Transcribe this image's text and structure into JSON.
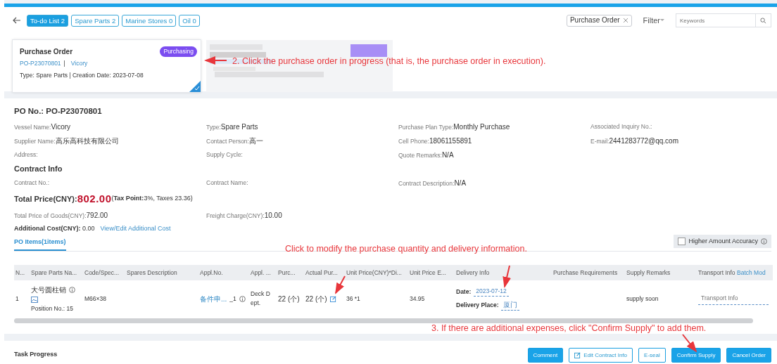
{
  "tabs": [
    {
      "label": "To-do List 2",
      "selected": true
    },
    {
      "label": "Spare Parts 2",
      "selected": false
    },
    {
      "label": "Marine Stores 0",
      "selected": false
    },
    {
      "label": "Oil 0",
      "selected": false
    }
  ],
  "filter_chip": {
    "label": "Purchase Order"
  },
  "filter": {
    "label": "Filter"
  },
  "search": {
    "placeholder": "Keywords"
  },
  "order_card": {
    "title": "Purchase Order",
    "status": "Purchasing",
    "po_no": "PO-P23070801",
    "separator": "|",
    "vessel": "Vicory",
    "meta": "Type:  Spare Parts | Creation Date:  2023-07-08",
    "selected": true
  },
  "details": {
    "po_title": "PO No.:  PO-P23070801",
    "rows": [
      [
        {
          "label": "Vessel Name:",
          "value": "Vicory"
        },
        {
          "label": "Type:",
          "value": "Spare Parts"
        },
        {
          "label": "Purchase Plan Type:",
          "value": "Monthly Purchase"
        },
        {
          "label": "Associated Inquiry No.:"
        }
      ],
      [
        {
          "label": "Supplier Name:",
          "value": "高乐高科技有限公司"
        },
        {
          "label": "Contact Person:",
          "value": "高一"
        },
        {
          "label": "Cell Phone:",
          "value": "18061155891"
        },
        {
          "label": "E-mail:",
          "value": "2441283772@qq.com"
        }
      ],
      [
        {
          "label": "Address:"
        },
        {
          "label": "Supply Cycle:"
        },
        {
          "label": "Quote Remarks:",
          "value": "N/A"
        }
      ]
    ],
    "contract_heading": "Contract Info",
    "contract_row": [
      {
        "label": "Contract No.:"
      },
      {
        "label": "Contract Name:"
      },
      {
        "label": "Contract Description:",
        "value": "N/A"
      }
    ],
    "total_label": "Total Price(CNY):",
    "total_value": "802.00",
    "total_note": "(**Tax Point:**3%, Taxes 23.36)",
    "price_row": [
      {
        "label": "Total Price of Goods(CNY):",
        "value": "792.00"
      },
      {
        "label": "Freight Charge(CNY):",
        "value": "10.00"
      }
    ],
    "additional_cost": "**Additional Cost(CNY):** 0.00",
    "additional_link": "View/Edit Additional Cost"
  },
  "items_tab": {
    "label": "PO Items(1items)",
    "selected": true
  },
  "accuracy": {
    "label": "Higher Amount Accuracy",
    "checked": false
  },
  "table": {
    "columns": [
      "N...",
      "Spare Parts Na...",
      "Code/Spec...",
      "Spares Description",
      "Appl.No.",
      "Appl. ...",
      "Purc...",
      "Actual Pur...",
      "Unit Price(CNY)*Di...",
      "Unit Price E...",
      "Delivery Info",
      "Purchase Requirements",
      "Supply Remarks",
      "Transport Info"
    ],
    "batch_link": "Batch Mod",
    "rows": [
      {
        "no": "1",
        "name": "大号圆柱销",
        "position": "Position No.:  15",
        "code": "M66×38",
        "appl_no": "备件申...",
        "appl_suffix": "_1",
        "appl_dept": "Deck Dept.",
        "purchase_qty": "22 (个)",
        "actual_qty": "22 (个)",
        "unit_price": "36 *1",
        "unit_price_e": "34.95",
        "date_label": "Date:",
        "date": "2023-07-12",
        "place_label": "Delivery Place:",
        "place": "厦门",
        "supply_remarks": "supply soon",
        "transport_placeholder": "Transport Info"
      }
    ]
  },
  "task_progress": "Task Progress",
  "buttons": [
    {
      "label": "Comment",
      "kind": "primary"
    },
    {
      "label": "Edit Contract Info",
      "kind": "outline-edit"
    },
    {
      "label": "E-seal",
      "kind": "outline"
    },
    {
      "label": "Confirm Supply",
      "kind": "primary"
    },
    {
      "label": "Cancel Order",
      "kind": "primary"
    }
  ],
  "annotations": [
    "2. Click the purchase order in progress (that is, the purchase order in execution).",
    "Click to modify the purchase quantity and delivery information.",
    "3. If there are additional expenses, click \"Confirm Supply\" to add them."
  ]
}
